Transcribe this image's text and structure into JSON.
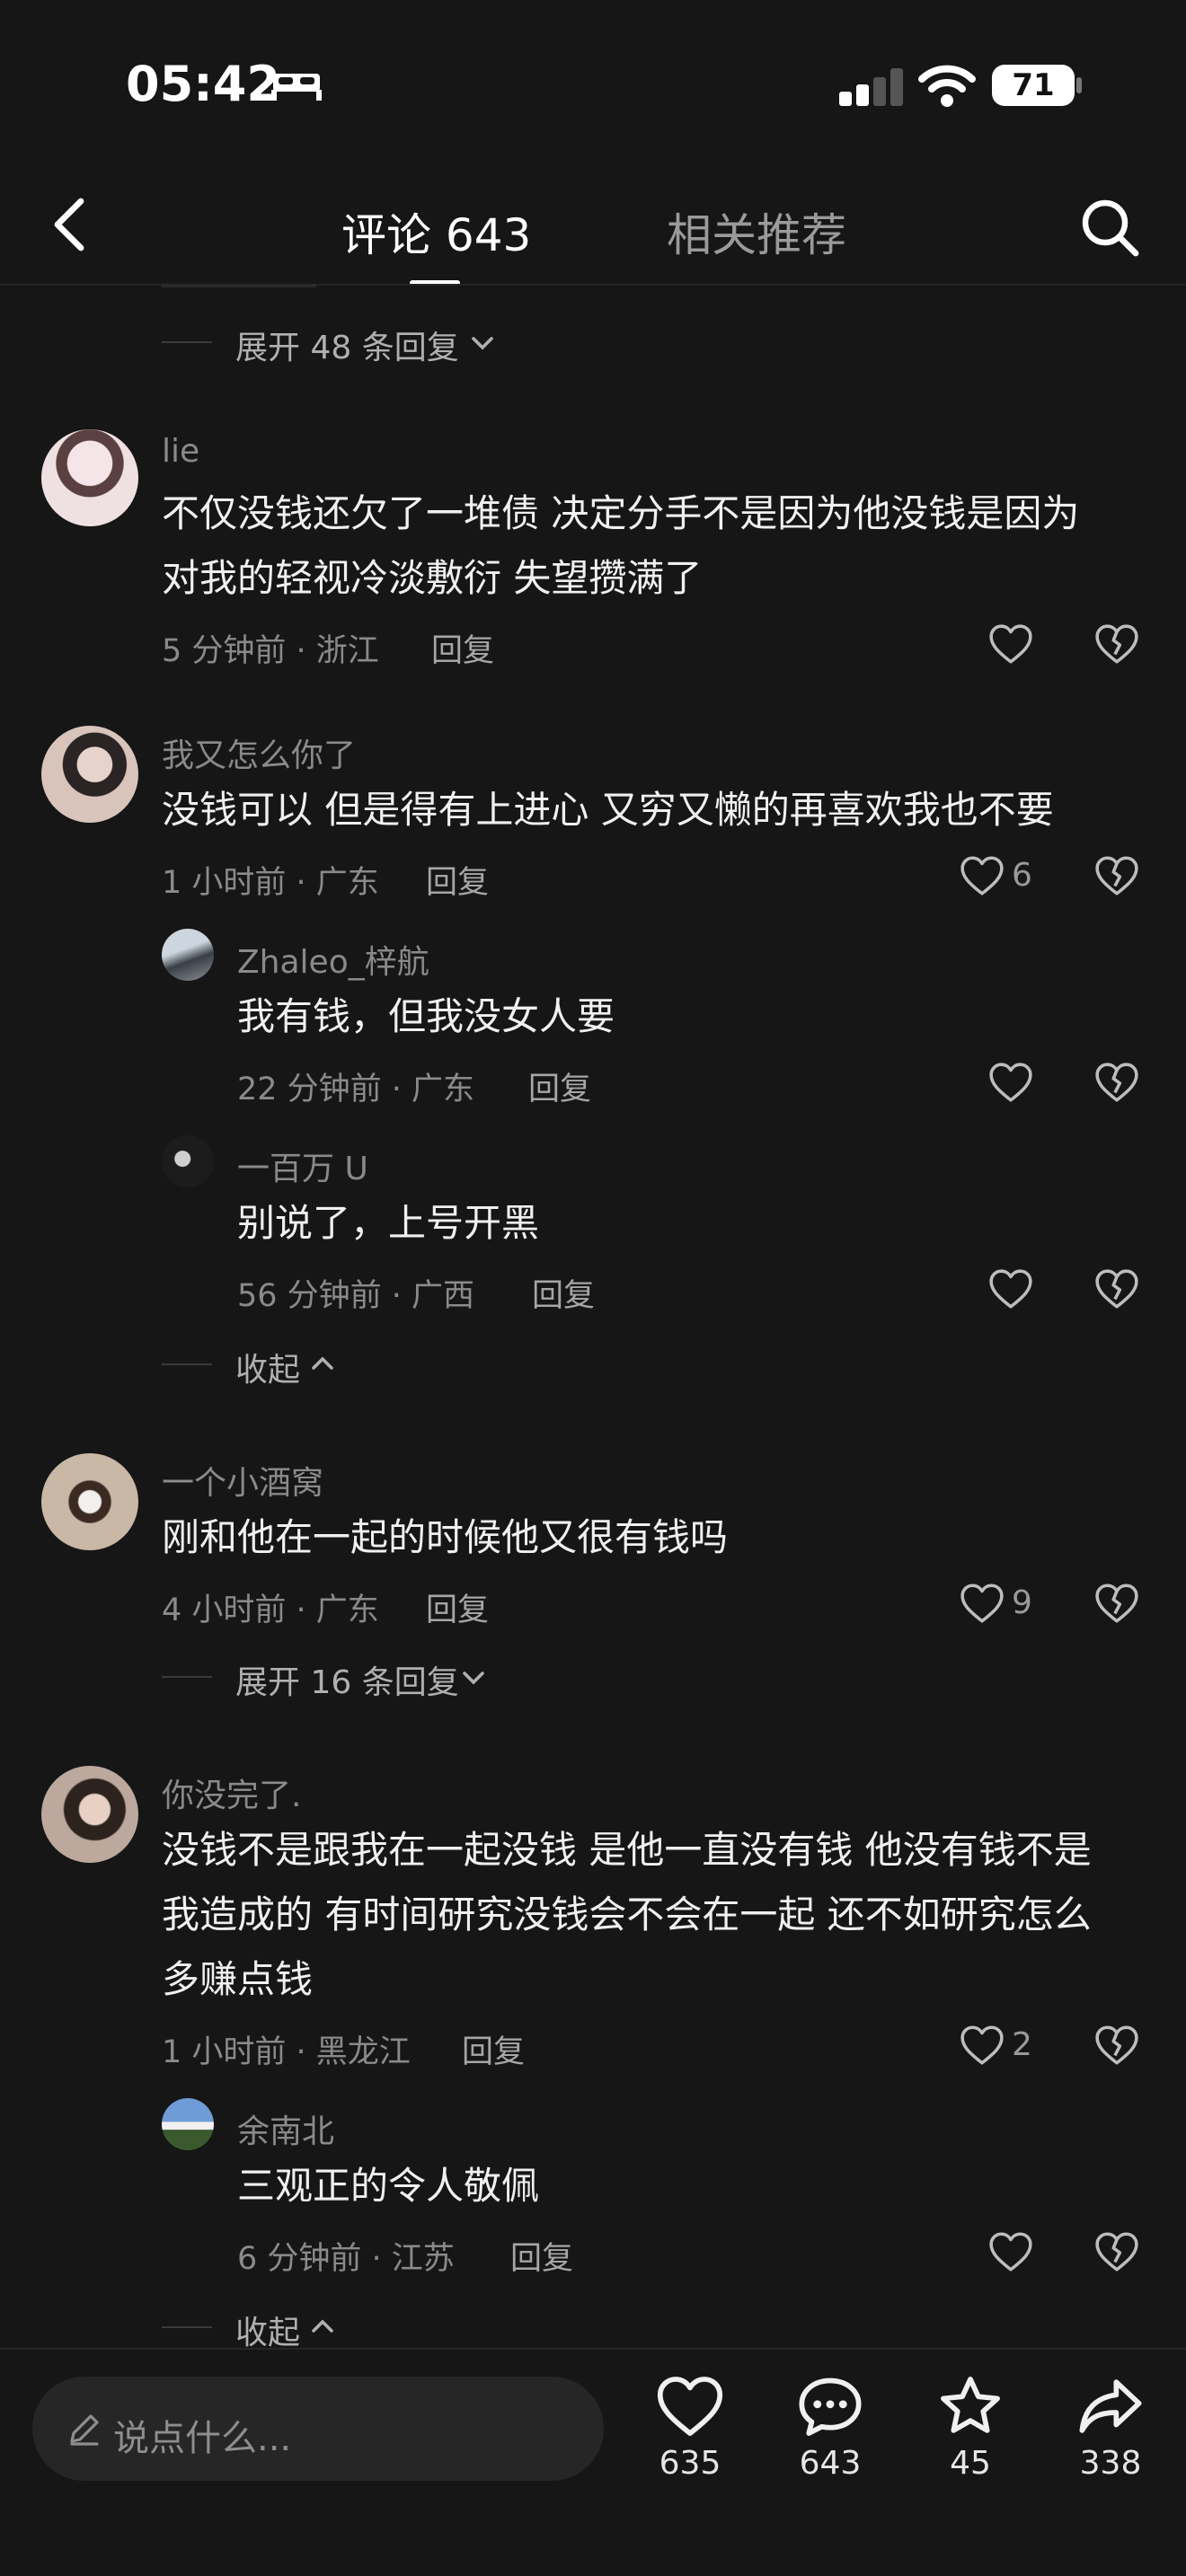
{
  "status_bar": {
    "time": "05:42",
    "battery": "71"
  },
  "header": {
    "tab_comments": "评论 643",
    "tab_related": "相关推荐"
  },
  "top_expand": "展开 48 条回复",
  "comments": [
    {
      "name": "lie",
      "text_lines": [
        "不仅没钱还欠了一堆债 决定分手不是因为他没钱是因为",
        "对我的轻视冷淡敷衍 失望攒满了"
      ],
      "meta": "5 分钟前 · 浙江",
      "reply": "回复",
      "likes": ""
    },
    {
      "name": "我又怎么你了",
      "text_lines": [
        "没钱可以 但是得有上进心 又穷又懒的再喜欢我也不要"
      ],
      "meta": "1 小时前 · 广东",
      "reply": "回复",
      "likes": "6",
      "replies": [
        {
          "name": "Zhaleo_梓航",
          "text": "我有钱，但我没女人要",
          "meta": "22 分钟前 · 广东",
          "reply": "回复"
        },
        {
          "name": "一百万 U",
          "text": "别说了，上号开黑",
          "meta": "56 分钟前 · 广西",
          "reply": "回复"
        }
      ],
      "collapse": "收起"
    },
    {
      "name": "一个小酒窝",
      "text_lines": [
        "刚和他在一起的时候他又很有钱吗"
      ],
      "meta": "4 小时前 · 广东",
      "reply": "回复",
      "likes": "9",
      "expand": "展开 16 条回复"
    },
    {
      "name": "你没完了.",
      "text_lines": [
        "没钱不是跟我在一起没钱 是他一直没有钱 他没有钱不是",
        "我造成的 有时间研究没钱会不会在一起 还不如研究怎么",
        "多赚点钱"
      ],
      "meta": "1 小时前 · 黑龙江",
      "reply": "回复",
      "likes": "2",
      "replies": [
        {
          "name": "余南北",
          "text": "三观正的令人敬佩",
          "meta": "6 分钟前 · 江苏",
          "reply": "回复"
        }
      ],
      "collapse": "收起"
    }
  ],
  "bottom_bar": {
    "placeholder": "说点什么...",
    "likes": "635",
    "comments": "643",
    "favorites": "45",
    "shares": "338"
  },
  "colors": {
    "background": "#161616",
    "text": "#f0f0f0",
    "secondary": "#8a8a8a"
  },
  "icons": [
    "bed-icon",
    "signal-icon",
    "wifi-icon",
    "battery-icon",
    "back-icon",
    "search-icon",
    "heart-icon",
    "dislike-icon",
    "chevron-down-icon",
    "chevron-up-icon",
    "pen-icon",
    "comment-icon",
    "star-icon",
    "share-icon"
  ]
}
